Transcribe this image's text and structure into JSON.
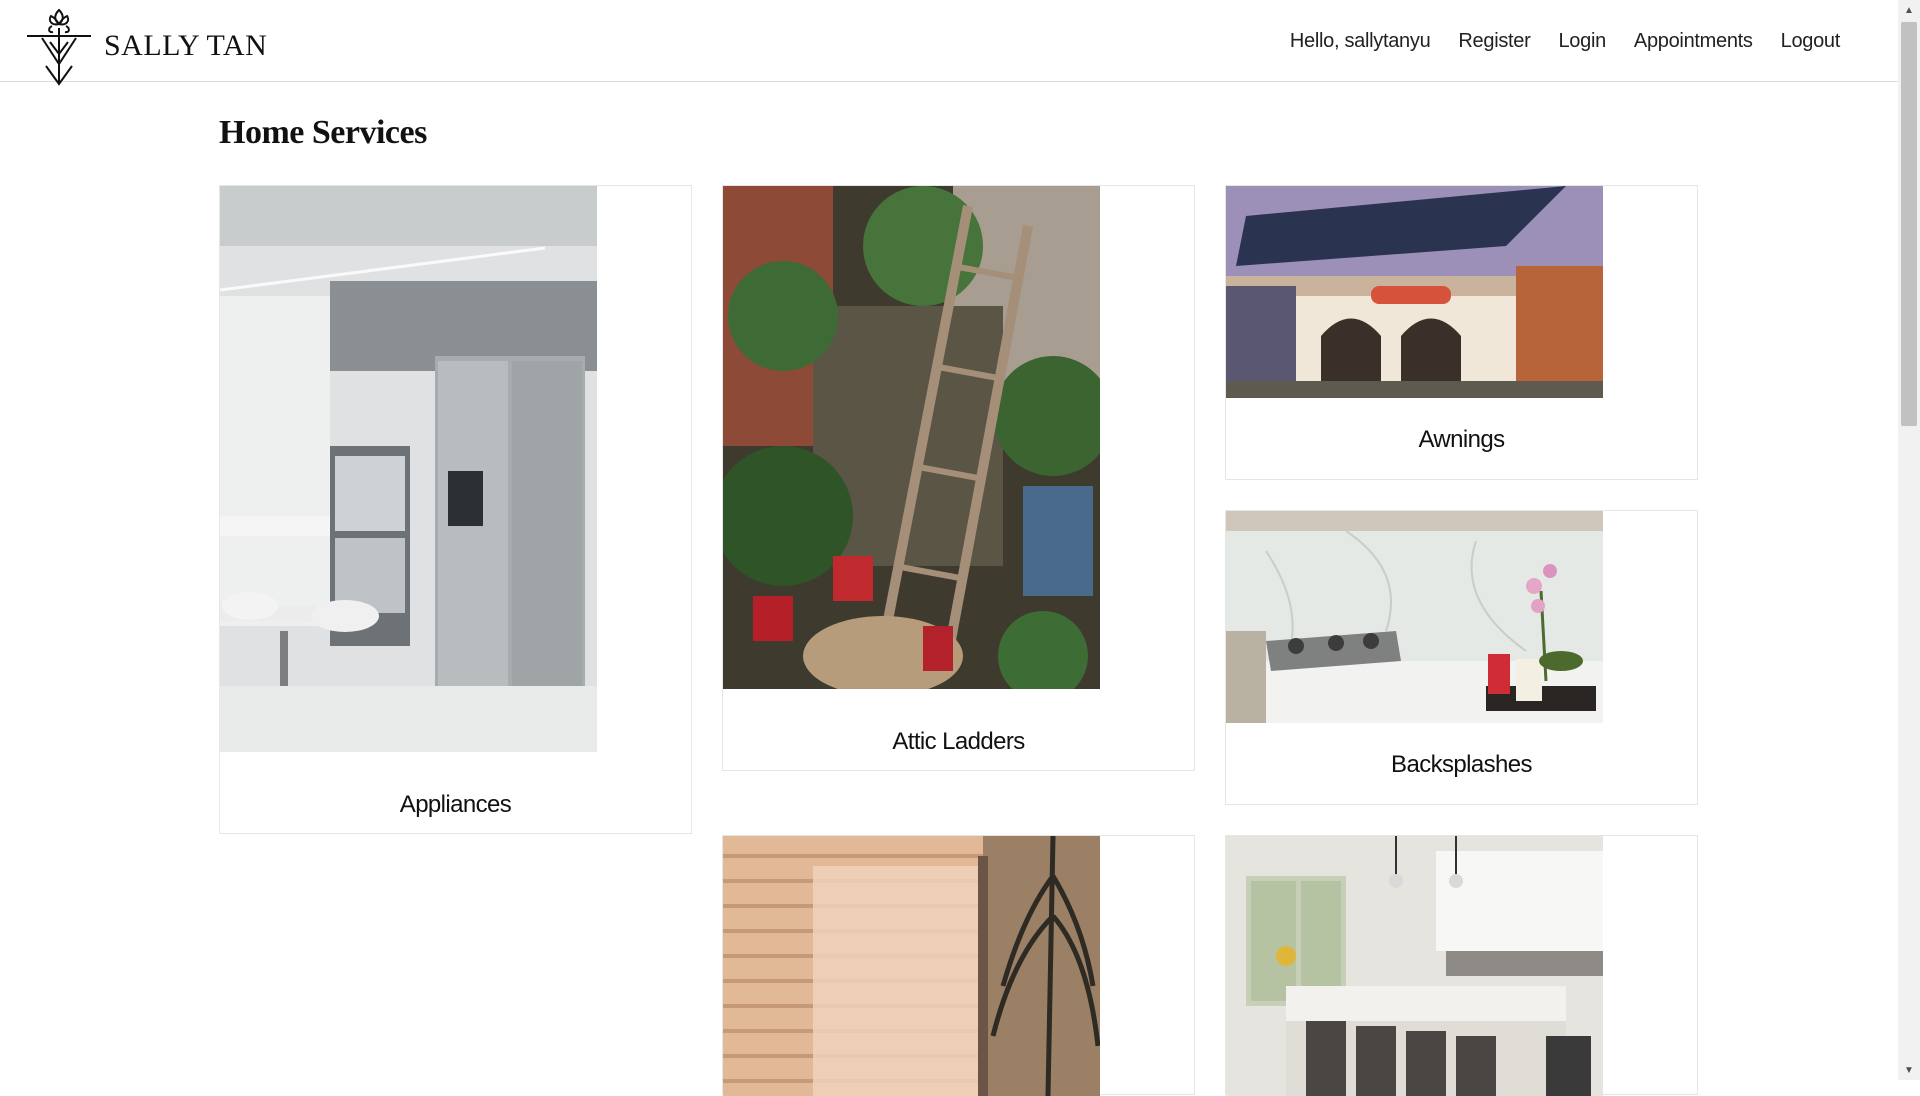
{
  "brand": {
    "name": "SALLY TAN",
    "logo_icon": "lotus-cross-logo"
  },
  "nav": {
    "greeting": "Hello, sallytanyu",
    "items": [
      {
        "label": "Register"
      },
      {
        "label": "Login"
      },
      {
        "label": "Appointments"
      },
      {
        "label": "Logout"
      }
    ]
  },
  "main": {
    "title": "Home Services",
    "cards": [
      {
        "label": "Appliances"
      },
      {
        "label": "Attic Ladders"
      },
      {
        "label": "Awnings"
      },
      {
        "label": "Backsplashes"
      },
      {
        "label": ""
      },
      {
        "label": ""
      }
    ]
  },
  "colors": {
    "text": "#111111",
    "border": "#e6e6e6",
    "background": "#ffffff"
  }
}
